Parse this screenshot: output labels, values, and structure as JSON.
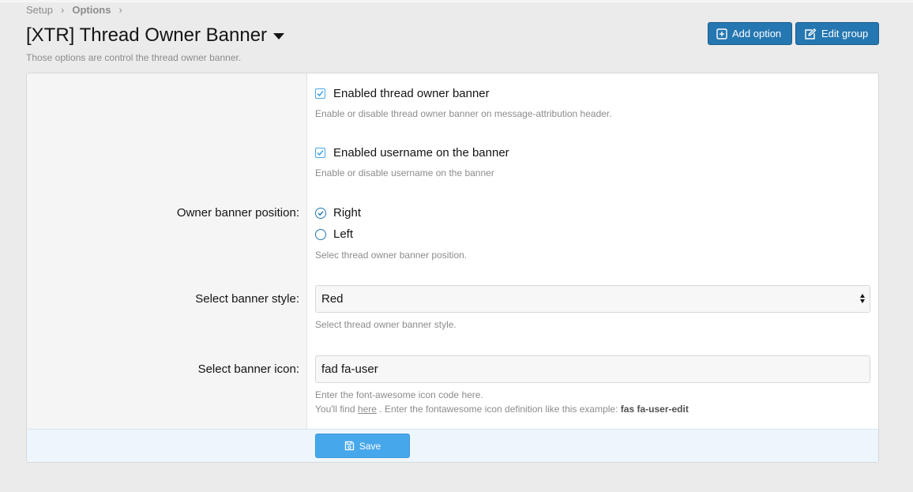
{
  "breadcrumb": {
    "items": [
      "Setup",
      "Options"
    ],
    "separator": "›"
  },
  "page": {
    "title": "[XTR] Thread Owner Banner",
    "description": "Those options are control the thread owner banner."
  },
  "header_buttons": {
    "add_option": "Add option",
    "edit_group": "Edit group"
  },
  "options": {
    "enabled_banner": {
      "label": "Enabled thread owner banner",
      "checked": true,
      "hint": "Enable or disable thread owner banner on message-attribution header."
    },
    "enabled_username": {
      "label": "Enabled username on the banner",
      "checked": true,
      "hint": "Enable or disable username on the banner"
    },
    "position": {
      "label": "Owner banner position:",
      "choices": [
        "Right",
        "Left"
      ],
      "selected": "Right",
      "hint": "Selec thread owner banner position."
    },
    "style": {
      "label": "Select banner style:",
      "value": "Red",
      "hint": "Select thread owner banner style."
    },
    "icon": {
      "label": "Select banner icon:",
      "value": "fad fa-user",
      "hint_line1": "Enter the font-awesome icon code here.",
      "hint_line2_prefix": "You'll find",
      "hint_link": "here",
      "hint_line2_middle": ". Enter the fontawesome icon definition like this example:",
      "hint_example": "fas fa-user-edit"
    }
  },
  "footer": {
    "save_label": "Save"
  },
  "colors": {
    "primary": "#2577b1",
    "save": "#47a7eb",
    "checkbox": "#47a7eb",
    "background": "#ebebeb"
  },
  "icons": {
    "add": "plus-square-icon",
    "edit": "edit-icon",
    "save": "save-icon"
  }
}
